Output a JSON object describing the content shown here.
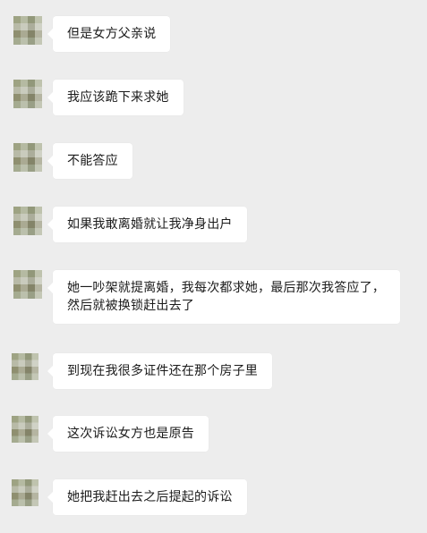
{
  "chat": {
    "messages": [
      {
        "text": "但是女方父亲说"
      },
      {
        "text": "我应该跪下来求她"
      },
      {
        "text": "不能答应"
      },
      {
        "text": "如果我敢离婚就让我净身出户"
      },
      {
        "text": "她一吵架就提离婚，我每次都求她，最后那次我答应了，然后就被换锁赶出去了"
      },
      {
        "text": "到现在我很多证件还在那个房子里"
      },
      {
        "text": "这次诉讼女方也是原告"
      },
      {
        "text": "她把我赶出去之后提起的诉讼"
      }
    ]
  }
}
